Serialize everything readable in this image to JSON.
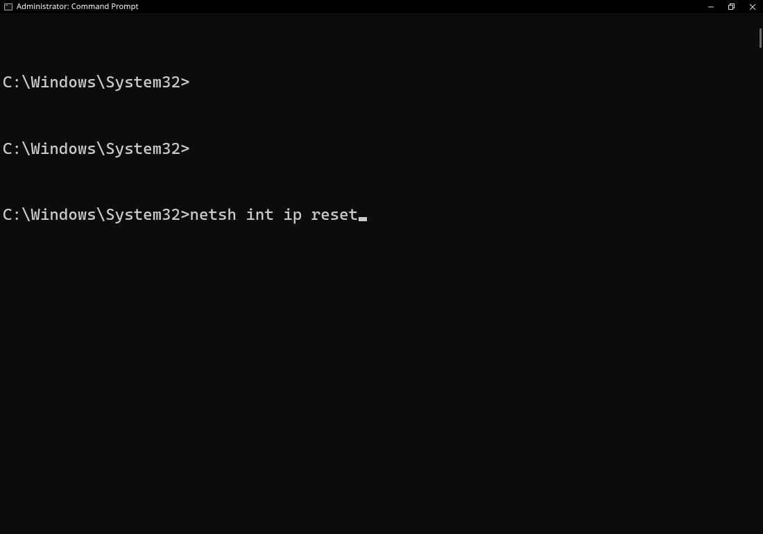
{
  "titlebar": {
    "label": "Administrator: Command Prompt"
  },
  "terminal": {
    "lines": [
      {
        "prompt": "C:\\Windows\\System32>",
        "input": ""
      },
      {
        "prompt": "C:\\Windows\\System32>",
        "input": ""
      },
      {
        "prompt": "C:\\Windows\\System32>",
        "input": "netsh int ip reset",
        "cursor": true
      }
    ]
  }
}
